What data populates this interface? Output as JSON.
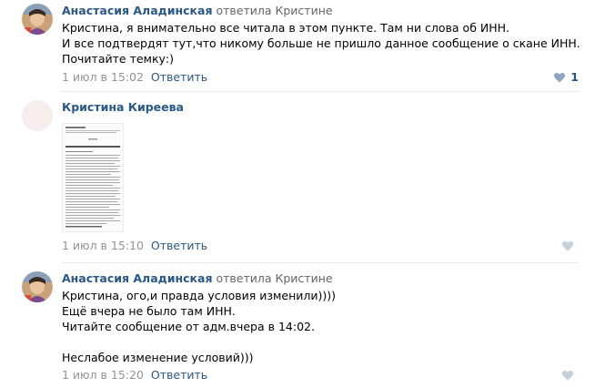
{
  "comments": [
    {
      "author": "Анастасия Аладинская",
      "reply_to": "ответила Кристине",
      "lines": [
        "Кристина, я внимательно все читала в этом пункте. Там ни слова об ИНН.",
        "И все подтвердят тут,что никому больше не пришло данное сообщение о скане ИНН.",
        "Почитайте темку:)"
      ],
      "date": "1 июл в 15:02",
      "reply_label": "Ответить",
      "likes": "1",
      "avatar_icon": "user-photo"
    },
    {
      "author": "Кристина Киреева",
      "reply_to": "",
      "lines": [],
      "attachment_icon": "document-scan-thumbnail",
      "date": "1 июл в 15:10",
      "reply_label": "Ответить",
      "likes": "",
      "avatar_icon": "user-photo-placeholder"
    },
    {
      "author": "Анастасия Аладинская",
      "reply_to": "ответила Кристине",
      "lines": [
        "Кристина, ого,и правда условия изменили))))",
        "Ещё вчера не было там ИНН.",
        "Читайте сообщение от адм.вчера в 14:02.",
        "",
        "Неслабое изменение условий)))"
      ],
      "date": "1 июл в 15:20",
      "reply_label": "Ответить",
      "likes": "",
      "avatar_icon": "user-photo"
    }
  ],
  "colors": {
    "link": "#2a5885",
    "meta": "#939393",
    "like_icon": "#c5d0db",
    "divider": "#e7e8ec"
  }
}
